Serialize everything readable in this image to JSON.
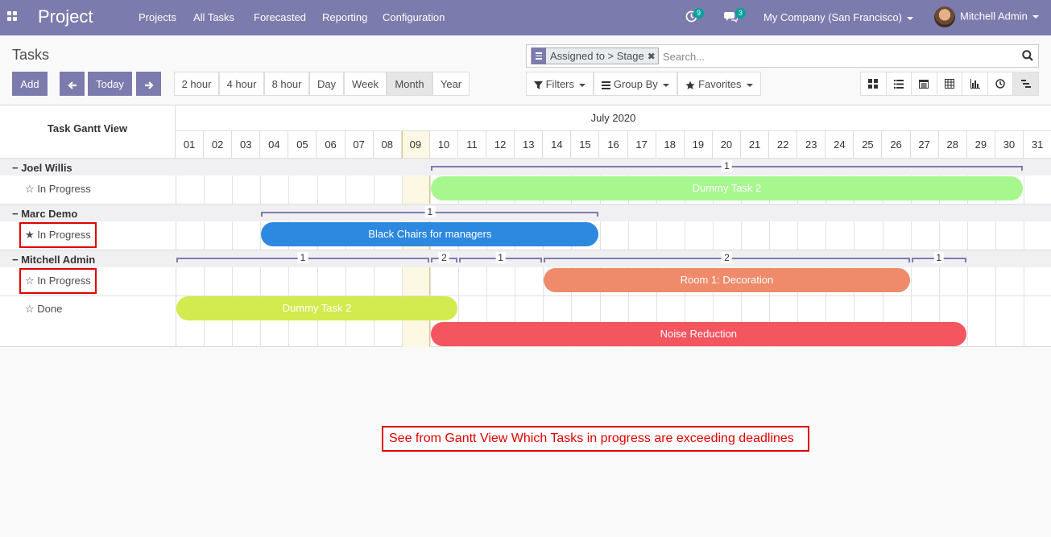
{
  "navbar": {
    "brand": "Project",
    "menu": [
      "Projects",
      "All Tasks",
      "Forecasted",
      "Reporting",
      "Configuration"
    ],
    "activity_count": "9",
    "messages_count": "3",
    "company": "My Company (San Francisco)",
    "user": "Mitchell Admin"
  },
  "control": {
    "title": "Tasks",
    "add_label": "Add",
    "today_label": "Today",
    "scales": [
      "2 hour",
      "4 hour",
      "8 hour",
      "Day",
      "Week",
      "Month",
      "Year"
    ],
    "active_scale": "Month",
    "facet": "Assigned to > Stage",
    "search_placeholder": "Search...",
    "filters_label": "Filters",
    "groupby_label": "Group By",
    "favorites_label": "Favorites"
  },
  "gantt": {
    "title": "Task Gantt View",
    "month": "July 2020",
    "days": [
      "01",
      "02",
      "03",
      "04",
      "05",
      "06",
      "07",
      "08",
      "09",
      "10",
      "11",
      "12",
      "13",
      "14",
      "15",
      "16",
      "17",
      "18",
      "19",
      "20",
      "21",
      "22",
      "23",
      "24",
      "25",
      "26",
      "27",
      "28",
      "29",
      "30",
      "31"
    ],
    "today_day": "09",
    "groups": [
      {
        "name": "Joel Willis",
        "rows": [
          {
            "label": "In Progress",
            "starred": false
          }
        ],
        "counters": [
          {
            "start": 10,
            "end": 30,
            "count": "1"
          }
        ]
      },
      {
        "name": "Marc Demo",
        "rows": [
          {
            "label": "In Progress",
            "starred": true
          }
        ],
        "counters": [
          {
            "start": 4,
            "end": 15,
            "count": "1"
          }
        ]
      },
      {
        "name": "Mitchell Admin",
        "rows": [
          {
            "label": "In Progress",
            "starred": false
          },
          {
            "label": "Done",
            "starred": false
          }
        ],
        "counters": [
          {
            "start": 1,
            "end": 9,
            "count": "1"
          },
          {
            "start": 10,
            "end": 10,
            "count": "2"
          },
          {
            "start": 11,
            "end": 13,
            "count": "1"
          },
          {
            "start": 14,
            "end": 26,
            "count": "2"
          },
          {
            "start": 27,
            "end": 28,
            "count": "1"
          }
        ]
      }
    ],
    "tasks": [
      {
        "name": "Dummy Task 2",
        "group": 0,
        "start": 10,
        "end": 30,
        "color": "#a6f88e"
      },
      {
        "name": "Black Chairs for managers",
        "group": 1,
        "start": 4,
        "end": 15,
        "color": "#2d88e0"
      },
      {
        "name": "Room 1: Decoration",
        "group": 2,
        "start": 14,
        "end": 26,
        "color": "#ef8a6b"
      },
      {
        "name": "Dummy Task 2",
        "group": 2,
        "start": 1,
        "end": 10,
        "color": "#d3eb4f"
      },
      {
        "name": "Noise Reduction",
        "group": 2,
        "start": 10,
        "end": 28,
        "color": "#f4555f"
      }
    ]
  },
  "annotation": "See from Gantt View Which Tasks in progress are exceeding deadlines"
}
